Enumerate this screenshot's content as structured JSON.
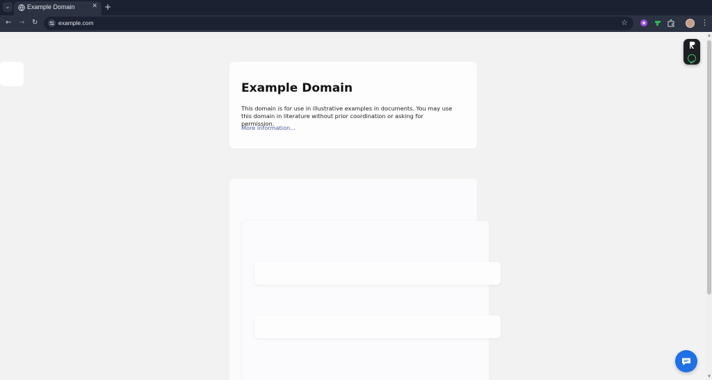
{
  "browser": {
    "tab": {
      "title": "Example Domain",
      "close_glyph": "✕"
    },
    "tab_list_glyph": "⌄",
    "new_tab_glyph": "+",
    "nav": {
      "back_glyph": "←",
      "forward_glyph": "→",
      "reload_glyph": "↻"
    },
    "omnibox": {
      "url": "example.com"
    },
    "bookmark_glyph": "☆",
    "menu_glyph": "⋮",
    "extensions": [
      "purple-extension-icon",
      "green-extension-icon",
      "puzzle-extensions-icon"
    ],
    "colors": {
      "chrome_dark": "#1b2130",
      "chrome_toolbar": "#2b3242"
    }
  },
  "page": {
    "heading": "Example Domain",
    "body": "This domain is for use in illustrative examples in documents. You may use this domain in literature without prior coordination or asking for permission.",
    "link": "More information...",
    "colors": {
      "background": "#f2f2f2",
      "card": "#fdfdfe",
      "link": "#4a5a9a",
      "chat_button": "#1f6fe5"
    }
  }
}
